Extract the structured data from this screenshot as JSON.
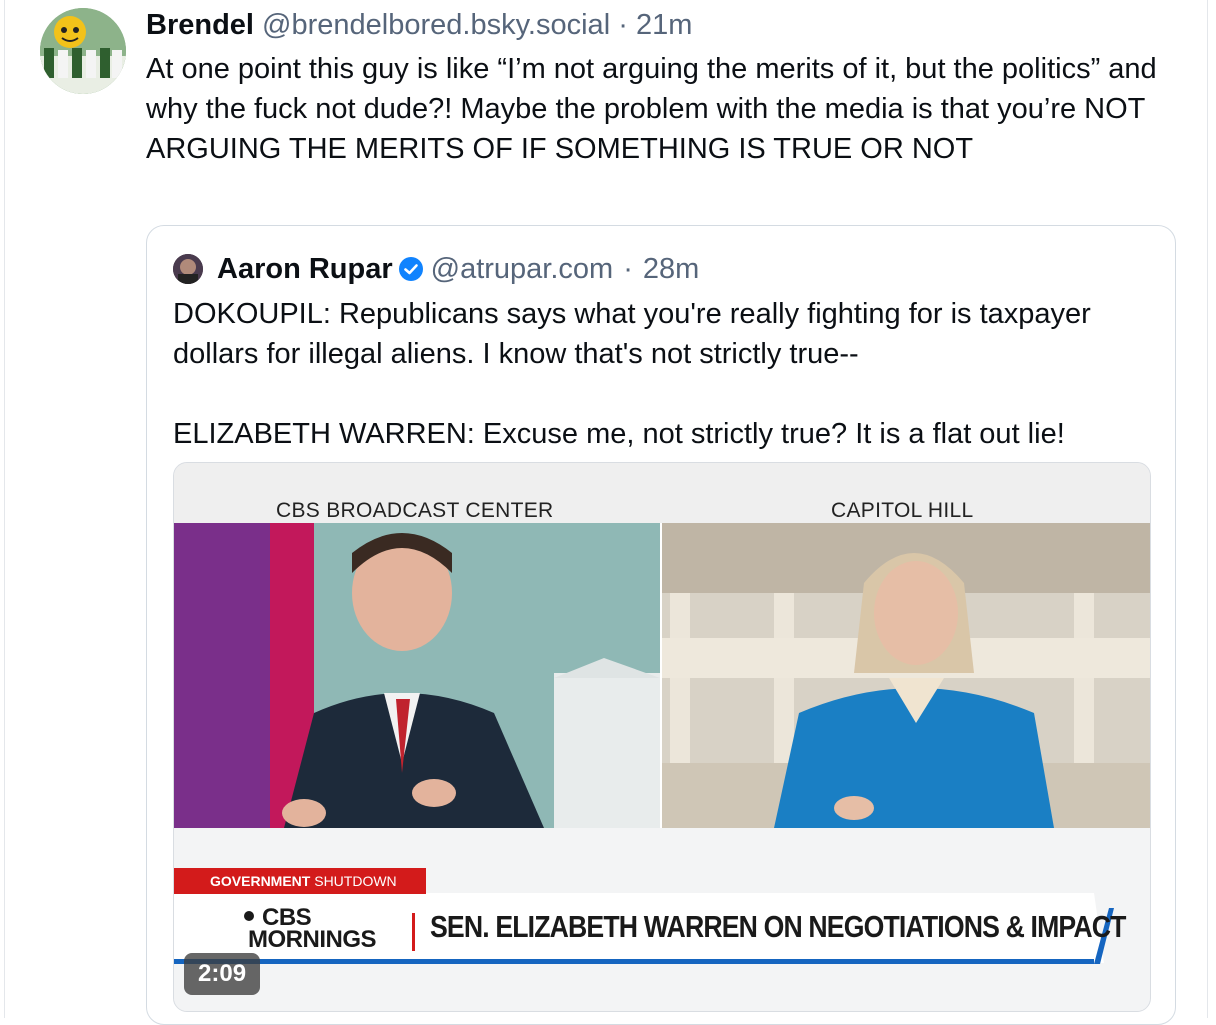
{
  "post": {
    "author_name": "Brendel",
    "handle": "@brendelbored.bsky.social",
    "separator": "·",
    "time": "21m",
    "text": "At one point this guy is like “I’m not arguing the merits of it, but the politics” and why the fuck not dude?! Maybe the problem with the media is that you’re NOT ARGUING THE MERITS OF IF SOMETHING IS TRUE OR NOT"
  },
  "quote": {
    "author_name": "Aaron Rupar",
    "handle": "@atrupar.com",
    "separator": "·",
    "time": "28m",
    "paragraph_1": "DOKOUPIL: Republicans says what you're really fighting for is taxpayer dollars for illegal aliens. I know that's not strictly true--",
    "paragraph_2": "ELIZABETH WARREN: Excuse me, not strictly true? It is a flat out lie!"
  },
  "video": {
    "left_location": "CBS BROADCAST CENTER",
    "right_location": "CAPITOL HILL",
    "tag_bold": "GOVERNMENT",
    "tag_light": "SHUTDOWN",
    "logo_line_1": "CBS",
    "logo_line_2": "MORNINGS",
    "headline": "SEN. ELIZABETH WARREN ON NEGOTIATIONS & IMPACT",
    "duration": "2:09"
  },
  "colors": {
    "accent_blue": "#1083fe",
    "cbs_red": "#d31b1b",
    "muted_text": "#56657a"
  }
}
